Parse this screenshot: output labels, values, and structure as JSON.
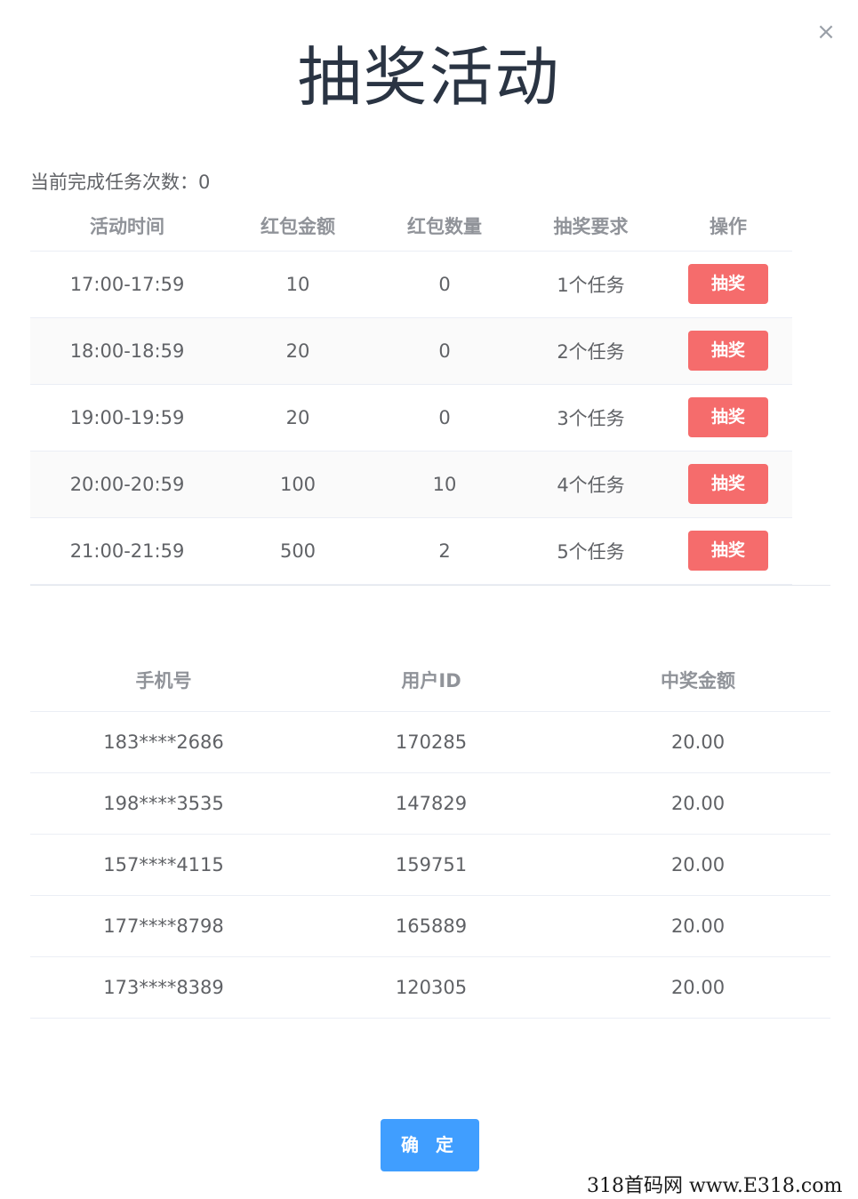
{
  "dialog": {
    "title": "抽奖活动",
    "close_icon": "close-icon",
    "close_glyph": "×",
    "task_count_text": "当前完成任务次数：0"
  },
  "activity_table": {
    "headers": [
      "活动时间",
      "红包金额",
      "红包数量",
      "抽奖要求",
      "操作"
    ],
    "rows": [
      {
        "time": "17:00-17:59",
        "amount": "10",
        "quantity": "0",
        "requirement": "1个任务",
        "action": "抽奖"
      },
      {
        "time": "18:00-18:59",
        "amount": "20",
        "quantity": "0",
        "requirement": "2个任务",
        "action": "抽奖"
      },
      {
        "time": "19:00-19:59",
        "amount": "20",
        "quantity": "0",
        "requirement": "3个任务",
        "action": "抽奖"
      },
      {
        "time": "20:00-20:59",
        "amount": "100",
        "quantity": "10",
        "requirement": "4个任务",
        "action": "抽奖"
      },
      {
        "time": "21:00-21:59",
        "amount": "500",
        "quantity": "2",
        "requirement": "5个任务",
        "action": "抽奖"
      }
    ]
  },
  "winners_table": {
    "headers": [
      "手机号",
      "用户ID",
      "中奖金额"
    ],
    "rows": [
      {
        "phone": "183****2686",
        "user_id": "170285",
        "prize": "20.00"
      },
      {
        "phone": "198****3535",
        "user_id": "147829",
        "prize": "20.00"
      },
      {
        "phone": "157****4115",
        "user_id": "159751",
        "prize": "20.00"
      },
      {
        "phone": "177****8798",
        "user_id": "165889",
        "prize": "20.00"
      },
      {
        "phone": "173****8389",
        "user_id": "120305",
        "prize": "20.00"
      }
    ]
  },
  "footer": {
    "confirm_label": "确 定"
  },
  "watermark": "318首码网 www.E318.com",
  "colors": {
    "draw_button": "#f56c6c",
    "confirm_button": "#409eff",
    "title": "#2a3443"
  }
}
